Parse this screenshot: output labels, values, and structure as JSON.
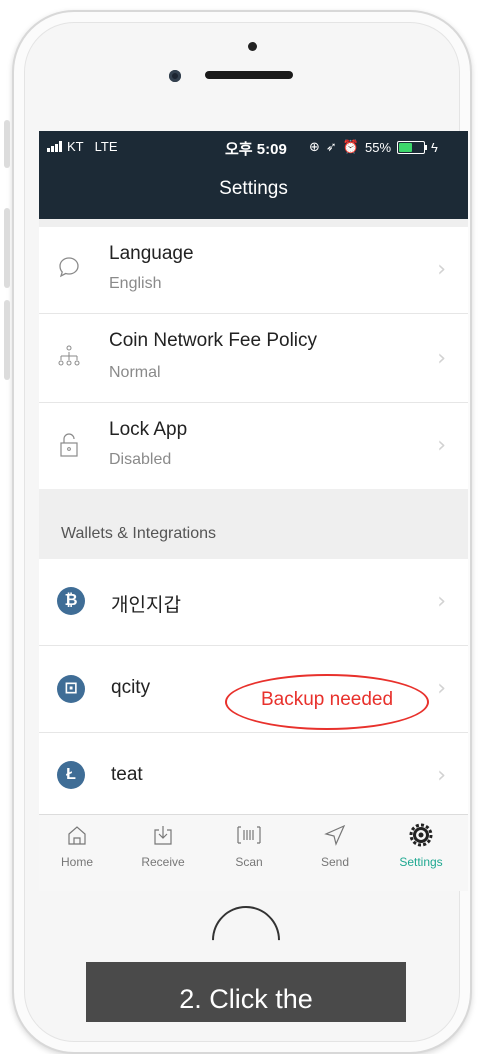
{
  "status_bar": {
    "carrier": "KT",
    "network": "LTE",
    "time": "오후 5:09",
    "battery_percent": "55%",
    "battery_level": 0.55
  },
  "nav": {
    "title": "Settings"
  },
  "settings": [
    {
      "label": "Language",
      "value": "English",
      "icon": "speech-bubble-icon"
    },
    {
      "label": "Coin Network Fee Policy",
      "value": "Normal",
      "icon": "network-tree-icon"
    },
    {
      "label": "Lock App",
      "value": "Disabled",
      "icon": "lock-icon"
    }
  ],
  "section_header": "Wallets & Integrations",
  "wallets": [
    {
      "name": "개인지갑",
      "coin_glyph": "₿",
      "icon": "bitcoin-icon"
    },
    {
      "name": "qcity",
      "coin_glyph": "⊡",
      "icon": "qtum-icon"
    },
    {
      "name": "teat",
      "coin_glyph": "Ł",
      "icon": "litecoin-icon"
    }
  ],
  "annotation": {
    "text": "Backup needed",
    "color": "#e8312c"
  },
  "tabs": [
    {
      "label": "Home",
      "icon": "home-icon"
    },
    {
      "label": "Receive",
      "icon": "receive-icon"
    },
    {
      "label": "Scan",
      "icon": "barcode-icon"
    },
    {
      "label": "Send",
      "icon": "send-icon"
    },
    {
      "label": "Settings",
      "icon": "gear-icon",
      "active": true
    }
  ],
  "caption": "2. Click the",
  "colors": {
    "nav_bg": "#1c2a36",
    "accent": "#1fa891",
    "coin_blue": "#3f6d96"
  }
}
